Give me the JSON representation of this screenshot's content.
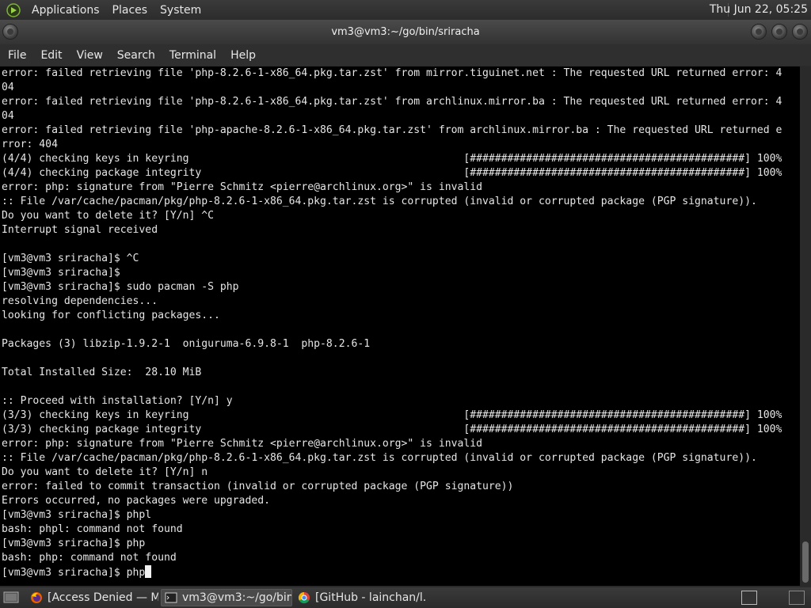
{
  "top_panel": {
    "menus": [
      "Applications",
      "Places",
      "System"
    ],
    "clock": "Thu Jun 22, 05:25"
  },
  "window": {
    "title": "vm3@vm3:~/go/bin/sriracha"
  },
  "menubar": [
    "File",
    "Edit",
    "View",
    "Search",
    "Terminal",
    "Help"
  ],
  "terminal": {
    "lines": [
      "error: failed retrieving file 'php-8.2.6-1-x86_64.pkg.tar.zst' from mirror.tiguinet.net : The requested URL returned error: 4",
      "04",
      "error: failed retrieving file 'php-8.2.6-1-x86_64.pkg.tar.zst' from archlinux.mirror.ba : The requested URL returned error: 4",
      "04",
      "error: failed retrieving file 'php-apache-8.2.6-1-x86_64.pkg.tar.zst' from archlinux.mirror.ba : The requested URL returned e",
      "rror: 404",
      "(4/4) checking keys in keyring                                            [############################################] 100%",
      "(4/4) checking package integrity                                          [############################################] 100%",
      "error: php: signature from \"Pierre Schmitz <pierre@archlinux.org>\" is invalid",
      ":: File /var/cache/pacman/pkg/php-8.2.6-1-x86_64.pkg.tar.zst is corrupted (invalid or corrupted package (PGP signature)).",
      "Do you want to delete it? [Y/n] ^C",
      "Interrupt signal received",
      "",
      "[vm3@vm3 sriracha]$ ^C",
      "[vm3@vm3 sriracha]$",
      "[vm3@vm3 sriracha]$ sudo pacman -S php",
      "resolving dependencies...",
      "looking for conflicting packages...",
      "",
      "Packages (3) libzip-1.9.2-1  oniguruma-6.9.8-1  php-8.2.6-1",
      "",
      "Total Installed Size:  28.10 MiB",
      "",
      ":: Proceed with installation? [Y/n] y",
      "(3/3) checking keys in keyring                                            [############################################] 100%",
      "(3/3) checking package integrity                                          [############################################] 100%",
      "error: php: signature from \"Pierre Schmitz <pierre@archlinux.org>\" is invalid",
      ":: File /var/cache/pacman/pkg/php-8.2.6-1-x86_64.pkg.tar.zst is corrupted (invalid or corrupted package (PGP signature)).",
      "Do you want to delete it? [Y/n] n",
      "error: failed to commit transaction (invalid or corrupted package (PGP signature))",
      "Errors occurred, no packages were upgraded.",
      "[vm3@vm3 sriracha]$ phpl",
      "bash: phpl: command not found",
      "[vm3@vm3 sriracha]$ php",
      "bash: php: command not found",
      "[vm3@vm3 sriracha]$ php"
    ]
  },
  "taskbar": {
    "tasks": [
      {
        "label": "[Access Denied — M...",
        "icon": "firefox-icon"
      },
      {
        "label": "vm3@vm3:~/go/bin...",
        "icon": "terminal-icon"
      },
      {
        "label": "[GitHub - lainchan/l...",
        "icon": "chrome-icon"
      }
    ]
  }
}
